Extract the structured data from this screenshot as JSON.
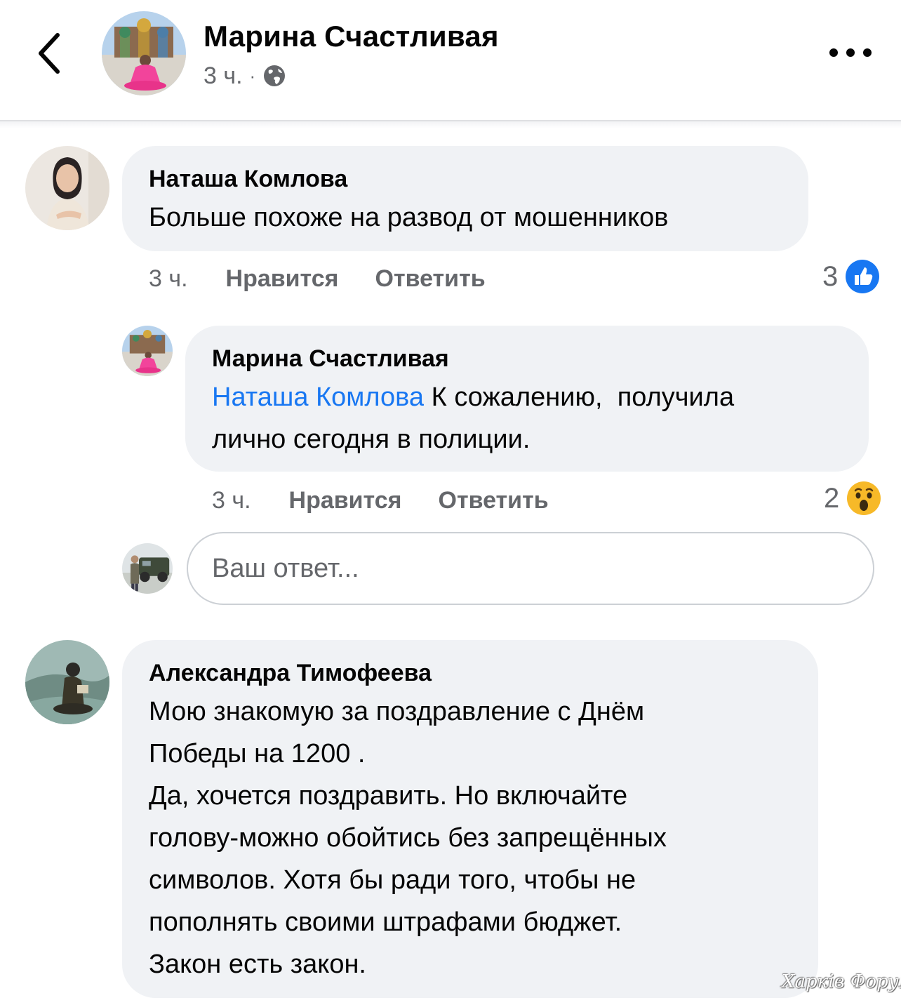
{
  "header": {
    "author_name": "Марина Счастливая",
    "time": "3 ч.",
    "separator": "·",
    "privacy_icon": "globe-icon",
    "back_icon": "chevron-left-icon",
    "more_icon": "more-horizontal-icon"
  },
  "comments": [
    {
      "author": "Наташа Комлова",
      "text": "Больше похоже на развод от мошенников",
      "time": "3 ч.",
      "like_label": "Нравится",
      "reply_label": "Ответить",
      "reaction_count": "3",
      "reaction_icon": "like-icon"
    },
    {
      "author": "Марина Счастливая",
      "mention": "Наташа Комлова",
      "text_line1": " К сожалению,  получила",
      "text_line2": "лично сегодня в полиции.",
      "time": "3 ч.",
      "like_label": "Нравится",
      "reply_label": "Ответить",
      "reaction_count": "2",
      "reaction_icon": "wow-icon"
    },
    {
      "author": "Александра Тимофеева",
      "lines": [
        "Мою знакомую за поздравление с Днём",
        "Победы на 1200 .",
        "Да, хочется поздравить. Но включайте",
        "голову-можно обойтись без запрещённых",
        "символов. Хотя бы ради того, чтобы не",
        "пополнять своими штрафами бюджет.",
        "Закон есть закон."
      ]
    }
  ],
  "reply_box": {
    "placeholder": "Ваш ответ...",
    "value": ""
  },
  "watermark": "Харків Форум",
  "colors": {
    "bubble": "#f0f2f5",
    "secondary_text": "#65676b",
    "mention": "#1877f2",
    "like_blue": "#1877f2",
    "wow_yellow": "#f7b928"
  }
}
